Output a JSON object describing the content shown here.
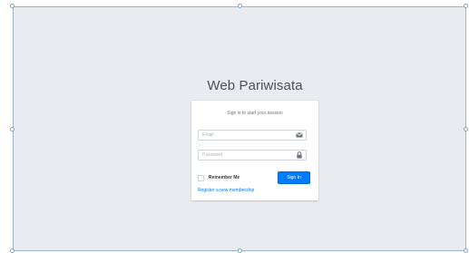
{
  "app": {
    "title": "Web Pariwisata"
  },
  "login": {
    "message": "Sign in to start your session",
    "email": {
      "placeholder": "Email",
      "value": "",
      "icon": "envelope-icon"
    },
    "password": {
      "placeholder": "Password",
      "value": "",
      "icon": "lock-icon"
    },
    "remember_label": "Remember Me",
    "remember_checked": false,
    "sign_in_label": "Sign In",
    "register_label": "Register a new membership"
  },
  "colors": {
    "page_background": "#e9ecef",
    "primary": "#007bff",
    "link": "#007bff",
    "selection_border": "#9fb4c8"
  }
}
